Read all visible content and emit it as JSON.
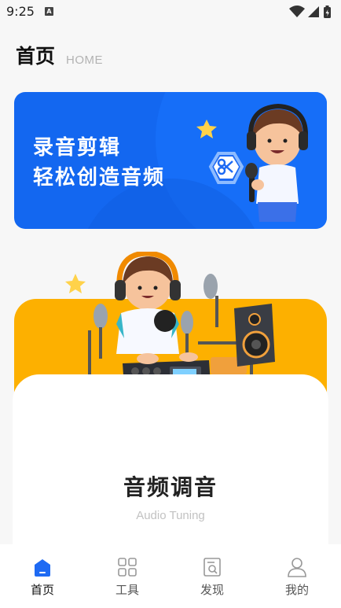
{
  "status_bar": {
    "time": "9:25",
    "notification_letter": "A"
  },
  "header": {
    "title": "首页",
    "subtitle": "HOME"
  },
  "banner": {
    "line1": "录音剪辑",
    "line2": "轻松创造音频",
    "bg_color": "#1367f0"
  },
  "feature_card": {
    "title": "音频调音",
    "subtitle": "Audio Tuning",
    "accent_color": "#fdb000"
  },
  "tabbar": {
    "active_color": "#1e6af3",
    "tabs": [
      {
        "label": "首页",
        "icon": "home-icon"
      },
      {
        "label": "工具",
        "icon": "grid-icon"
      },
      {
        "label": "发现",
        "icon": "discover-icon"
      },
      {
        "label": "我的",
        "icon": "profile-icon"
      }
    ]
  }
}
